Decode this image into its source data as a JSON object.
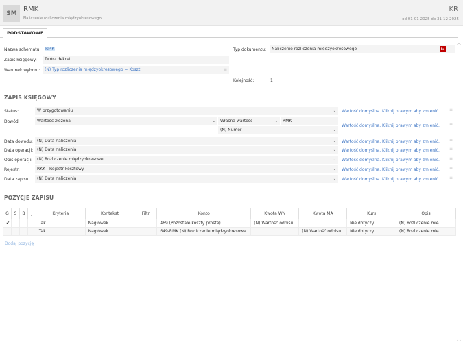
{
  "header": {
    "avatar": "SM",
    "title": "RMK",
    "subtitle": "Naliczenie rozliczenia międzyokresowego",
    "code": "KR",
    "date_range": "od 01-01-2025 do 31-12-2025"
  },
  "tabs": [
    {
      "label": "PODSTAWOWE"
    }
  ],
  "basic": {
    "schema_name_label": "Nazwa schematu:",
    "schema_name_value": "RMK",
    "posting_label": "Zapis księgowy:",
    "posting_value": "Twórz dekret",
    "condition_label": "Warunek wyboru:",
    "condition_value": "(N) Typ rozliczenia międzyokresowego = Koszt",
    "doctype_label": "Typ dokumentu:",
    "doctype_value": "Naliczenie rozliczenia międzyokresowego",
    "doctype_badge": "Re",
    "order_label": "Kolejność:",
    "order_value": "1"
  },
  "posting_section": {
    "title": "ZAPIS KSIĘGOWY",
    "default_text": "Wartość domyślna. Kliknij prawym aby zmienić.",
    "status_label": "Status:",
    "status_value": "W przygotowaniu",
    "proof_label": "Dowód:",
    "proof_value": "Wartość złożona",
    "proof_own_value": "Własna wartość",
    "proof_rmk": "RMK",
    "proof_number": "(N) Numer",
    "proof_date_label": "Data dowodu:",
    "proof_date_value": "(N) Data naliczenia",
    "op_date_label": "Data operacji:",
    "op_date_value": "(N) Data naliczenia",
    "op_desc_label": "Opis operacji:",
    "op_desc_value": "(N) Rozliczenie międzyokresowe",
    "register_label": "Rejestr:",
    "register_value": "RKK - Rejestr kosztowy",
    "entry_date_label": "Data zapisu:",
    "entry_date_value": "(N) Data naliczenia"
  },
  "positions": {
    "title": "POZYCJE ZAPISU",
    "columns": [
      "G",
      "S",
      "B",
      "J",
      "Kryteria",
      "Kontekst",
      "Filtr",
      "Konto",
      "Kwota WN",
      "Kwota MA",
      "Kurs",
      "Opis"
    ],
    "rows": [
      {
        "check": "✔",
        "kryteria": "Tak",
        "kontekst": "Nagłówek",
        "filtr": "",
        "konto": "469 (Pozostałe koszty proste)",
        "wn": "(N) Wartość odpisu",
        "ma": "",
        "kurs": "Nie dotyczy",
        "opis": "(N) Rozliczenie mię..."
      },
      {
        "check": "",
        "kryteria": "Tak",
        "kontekst": "Nagłówek",
        "filtr": "",
        "konto": "649-RMK (N) Rozliczenie międzyokresowe",
        "wn": "",
        "ma": "(N) Wartość odpisu",
        "kurs": "Nie dotyczy",
        "opis": "(N) Rozliczenie mię..."
      }
    ],
    "add_label": "Dodaj pozycję"
  },
  "icons": {
    "dropdown": "chevron-down-icon",
    "menu": "hamburger-menu-icon",
    "check": "check-icon"
  },
  "colors": {
    "link": "#3c74c4",
    "badge": "#c00000",
    "header_bg": "#f2f2f2"
  }
}
